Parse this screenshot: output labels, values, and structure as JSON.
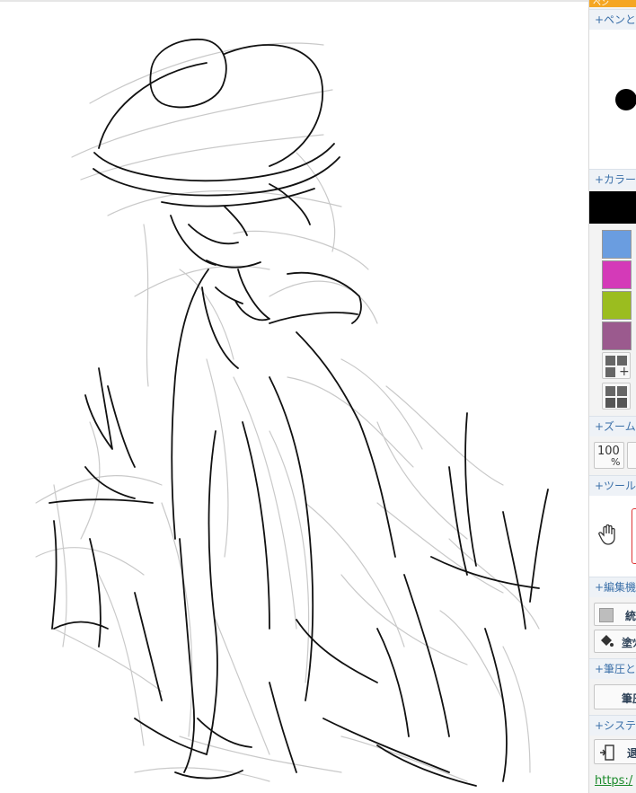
{
  "sidebar": {
    "top_tab": "ペン",
    "sections": [
      {
        "id": "pen",
        "label": "+ペンと消"
      },
      {
        "id": "palette",
        "label": "+カラーピ"
      },
      {
        "id": "zoom",
        "label": "+ズーム"
      },
      {
        "id": "tools",
        "label": "+ツール"
      },
      {
        "id": "edit",
        "label": "+編集機"
      },
      {
        "id": "pressure",
        "label": "+筆圧と"
      },
      {
        "id": "system",
        "label": "+システム"
      }
    ],
    "current_color": "#000000",
    "palette_colors": [
      "#6a9de0",
      "#d43ab8",
      "#9bbd1f",
      "#9b5a8e"
    ],
    "zoom_label": "100",
    "zoom_unit": "%",
    "edit_items": [
      "統",
      "塗ﾂ"
    ],
    "pressure_button": "筆圧",
    "system_button": "退",
    "link_text": "https:/"
  }
}
